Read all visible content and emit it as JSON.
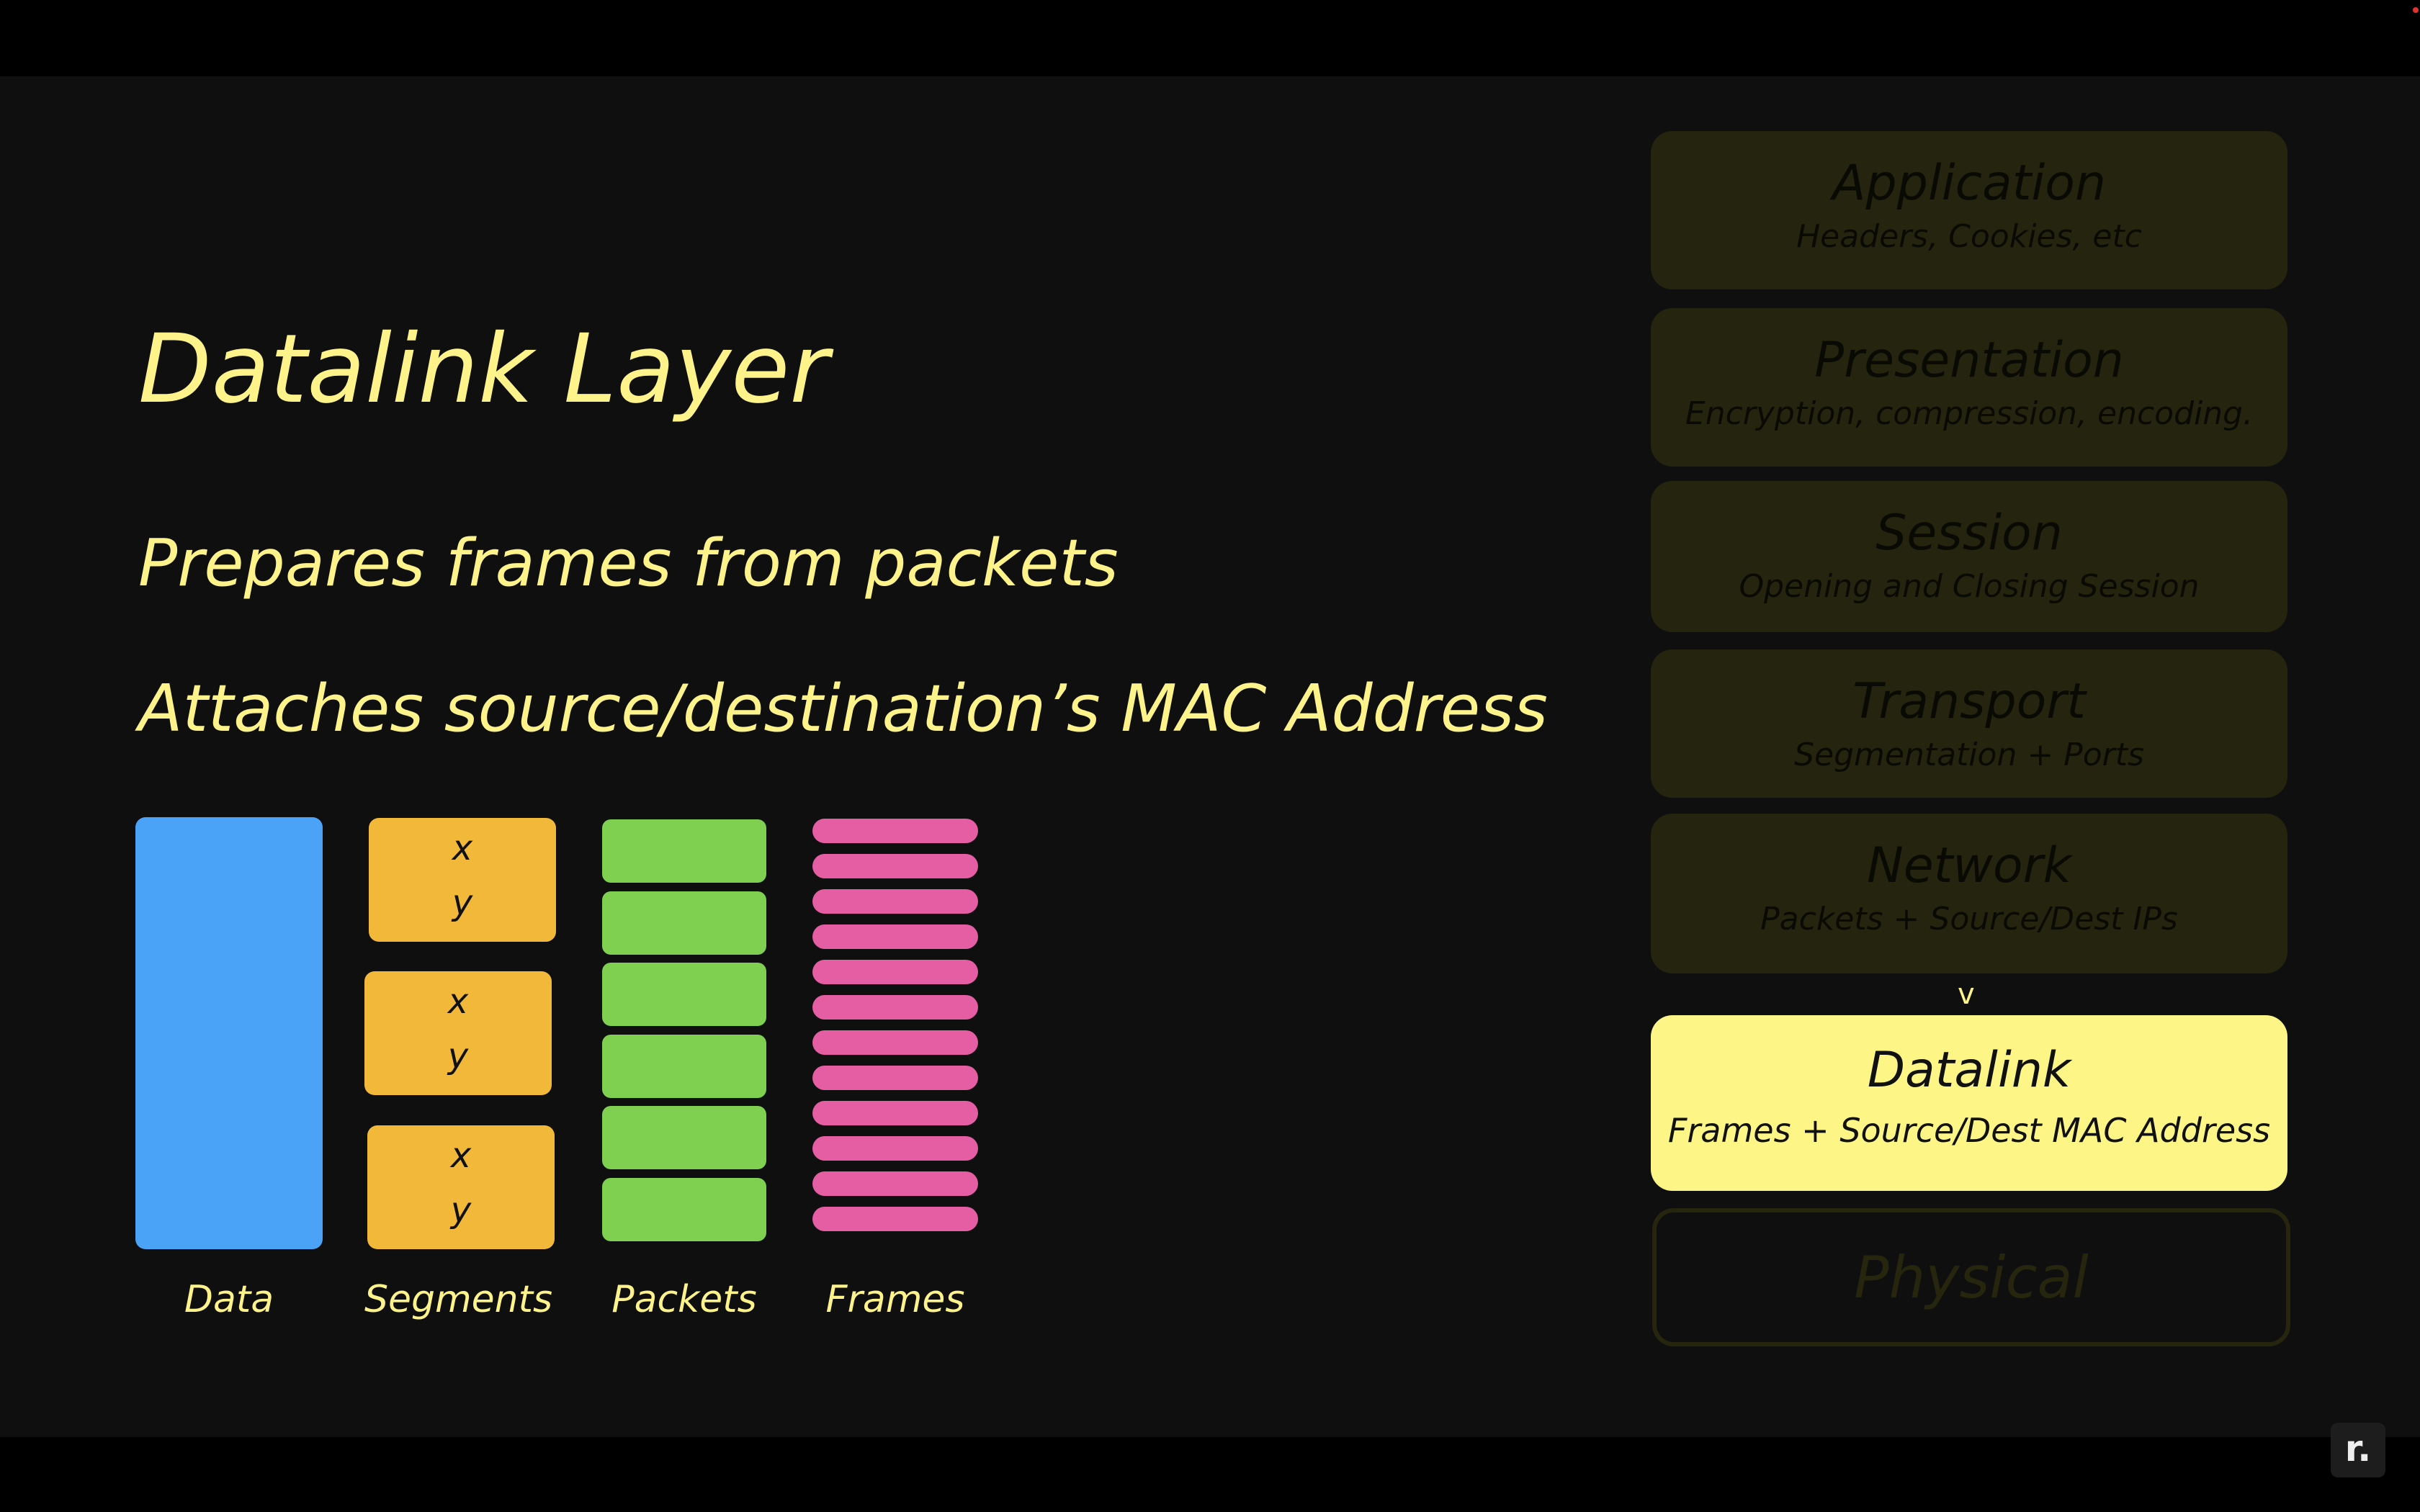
{
  "slide": {
    "title": "Datalink Layer",
    "bullets": [
      "Prepares frames from packets",
      "Attaches source/destination’s MAC Address"
    ]
  },
  "diagram": {
    "labels": [
      "Data",
      "Segments",
      "Packets",
      "Frames"
    ],
    "segment_x": "x",
    "segment_y": "y",
    "segment_count": 3,
    "packet_count": 6,
    "frame_count": 12,
    "colors": {
      "data": "#4aa3f7",
      "segments": "#f2b83a",
      "packets": "#7fd050",
      "frames": "#e55da3"
    }
  },
  "osi": {
    "layers": [
      {
        "name": "Application",
        "desc": "Headers, Cookies, etc"
      },
      {
        "name": "Presentation",
        "desc": "Encryption, compression, encoding."
      },
      {
        "name": "Session",
        "desc": "Opening and Closing Session"
      },
      {
        "name": "Transport",
        "desc": "Segmentation + Ports"
      },
      {
        "name": "Network",
        "desc": "Packets + Source/Dest IPs"
      },
      {
        "name": "Datalink",
        "desc": "Frames + Source/Dest MAC Address"
      },
      {
        "name": "Physical",
        "desc": ""
      }
    ],
    "active_layer": "Datalink",
    "arrow": "v"
  },
  "logo": {
    "text": "r."
  },
  "colors": {
    "accent": "#fdf38a",
    "background": "#0f0f0f",
    "active_layer": "#fdf687",
    "inactive_layer": "#24240f"
  }
}
